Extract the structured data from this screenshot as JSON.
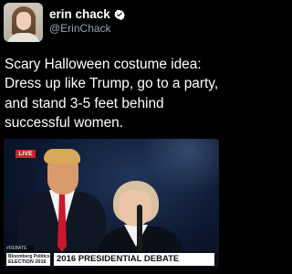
{
  "tweet": {
    "display_name": "erin chack",
    "handle": "@ErinChack",
    "verified": true,
    "text": "Scary Halloween costume idea: Dress up like Trump, go to a party, and stand 3-5 feet behind successful women."
  },
  "media": {
    "live_label": "LIVE",
    "tag_label": "#DEBATE",
    "network_brand": "Bloomberg Politics",
    "network_sub": "ELECTION 2016",
    "headline": "2016 PRESIDENTIAL DEBATE"
  },
  "colors": {
    "background": "#000000",
    "verified_badge": "#ffffff",
    "live_badge": "#c9242a"
  },
  "icons": {
    "verified": "verified-badge-icon"
  }
}
